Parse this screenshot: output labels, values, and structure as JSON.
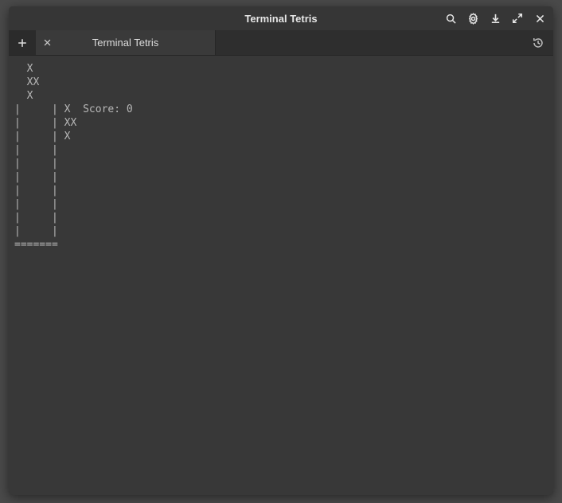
{
  "window": {
    "title": "Terminal Tetris"
  },
  "tabs": [
    {
      "label": "Terminal Tetris"
    }
  ],
  "game": {
    "score_label": "Score:",
    "score_value": 0,
    "next_piece_shape": [
      "X",
      "XX",
      "X"
    ],
    "board_width_cells": 5,
    "preview_rows": [
      "  X ",
      "  XX",
      "  X "
    ],
    "board_rows": [
      {
        "interior": "     ",
        "side_preview": "X",
        "side_extra": ""
      },
      {
        "interior": "     ",
        "side_preview": "XX",
        "side_extra": ""
      },
      {
        "interior": "     ",
        "side_preview": "X",
        "side_extra": ""
      },
      {
        "interior": "     ",
        "side_preview": "",
        "side_extra": ""
      },
      {
        "interior": "     ",
        "side_preview": "",
        "side_extra": ""
      },
      {
        "interior": "     ",
        "side_preview": "",
        "side_extra": ""
      },
      {
        "interior": "     ",
        "side_preview": "",
        "side_extra": ""
      },
      {
        "interior": "     ",
        "side_preview": "",
        "side_extra": ""
      },
      {
        "interior": "     ",
        "side_preview": "",
        "side_extra": ""
      },
      {
        "interior": "     ",
        "side_preview": "",
        "side_extra": ""
      }
    ],
    "bottom_border": "======="
  },
  "colors": {
    "window_bg": "#333333",
    "terminal_bg": "#383838",
    "terminal_fg": "#b7b7b7",
    "tab_active_bg": "#3a3a3a"
  }
}
